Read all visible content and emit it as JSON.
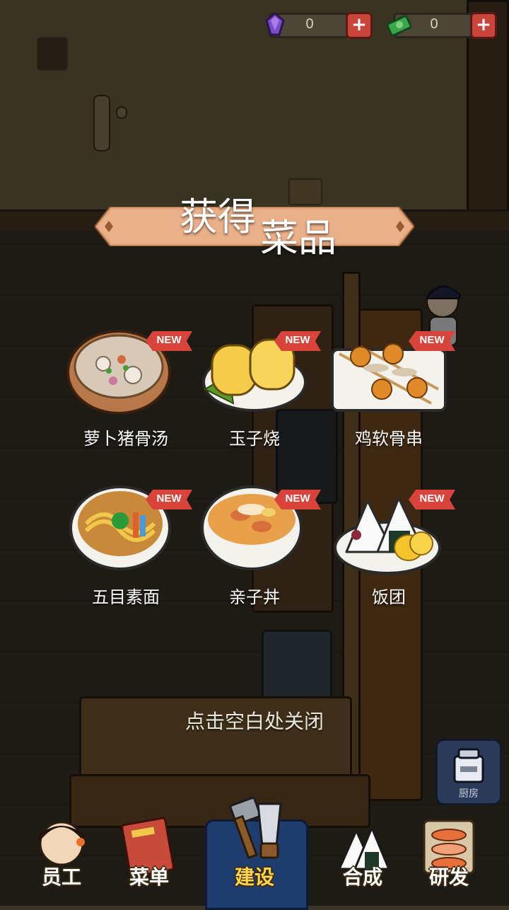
{
  "currency": [
    {
      "icon": "purple-gem-icon",
      "value": "0",
      "color": "#7a4bc8"
    },
    {
      "icon": "green-cash-icon",
      "value": "0",
      "color": "#3aa64a"
    }
  ],
  "banner": {
    "title_part1": "获得",
    "title_part2": "菜品"
  },
  "badge_text": "NEW",
  "dishes": [
    {
      "name": "萝卜猪骨汤",
      "icon": "radish-pork-bone-soup-icon"
    },
    {
      "name": "玉子烧",
      "icon": "tamagoyaki-icon"
    },
    {
      "name": "鸡软骨串",
      "icon": "chicken-cartilage-skewer-icon"
    },
    {
      "name": "五目素面",
      "icon": "gomoku-somen-icon"
    },
    {
      "name": "亲子丼",
      "icon": "oyakodon-icon"
    },
    {
      "name": "饭团",
      "icon": "onigiri-icon"
    }
  ],
  "close_hint": "点击空白处关闭",
  "kitchen_button": {
    "label": "厨房",
    "icon": "kitchen-stove-icon"
  },
  "nav": [
    {
      "label": "员工",
      "icon": "staff-avatar-icon",
      "active": false
    },
    {
      "label": "菜单",
      "icon": "menu-book-icon",
      "active": false
    },
    {
      "label": "建设",
      "icon": "hammer-saw-icon",
      "active": true
    },
    {
      "label": "合成",
      "icon": "onigiri-merge-icon",
      "active": false
    },
    {
      "label": "研发",
      "icon": "sushi-research-icon",
      "active": false
    }
  ],
  "colors": {
    "banner": "#e8a878",
    "badge": "#d8443c",
    "nav_active": "#1e3d6e",
    "nav_active_label": "#ffd54a"
  }
}
